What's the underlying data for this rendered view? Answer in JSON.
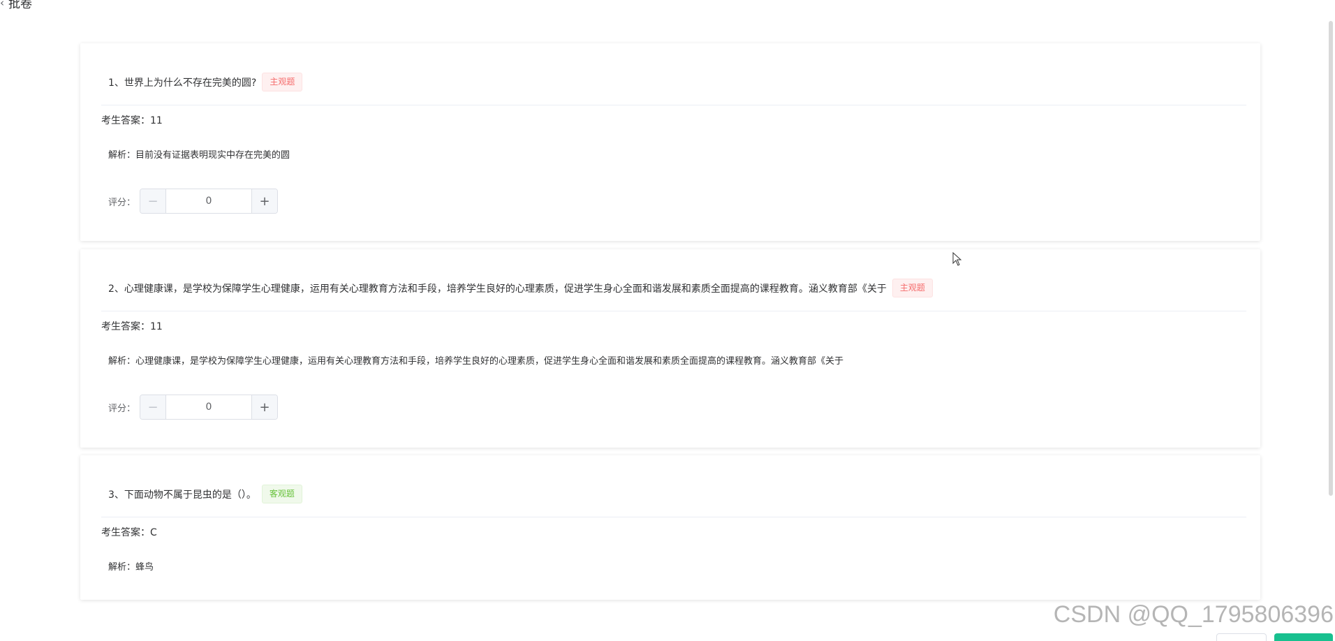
{
  "header": {
    "title": "批卷"
  },
  "questions": [
    {
      "title": "1、世界上为什么不存在完美的圆?",
      "tag": "主观题",
      "answer": "考生答案：11",
      "analysis": "解析：目前没有证据表明现实中存在完美的圆",
      "score_label": "评分：",
      "score_value": "0"
    },
    {
      "title": "2、心理健康课，是学校为保障学生心理健康，运用有关心理教育方法和手段，培养学生良好的心理素质，促进学生身心全面和谐发展和素质全面提高的课程教育。涵义教育部《关于",
      "tag": "主观题",
      "answer": "考生答案：11",
      "analysis": "解析：心理健康课，是学校为保障学生心理健康，运用有关心理教育方法和手段，培养学生良好的心理素质，促进学生身心全面和谐发展和素质全面提高的课程教育。涵义教育部《关于",
      "score_label": "评分：",
      "score_value": "0"
    },
    {
      "title": "3、下面动物不属于昆虫的是（）。",
      "tag": "客观题",
      "answer": "考生答案：C",
      "analysis": "解析：蜂鸟"
    }
  ],
  "stepper": {
    "minus": "−",
    "plus": "+"
  },
  "watermark": "CSDN @QQ_1795806396",
  "colors": {
    "subjective_tag": "#f56c6c",
    "objective_tag": "#67c23a",
    "primary_button": "#18c08f"
  }
}
